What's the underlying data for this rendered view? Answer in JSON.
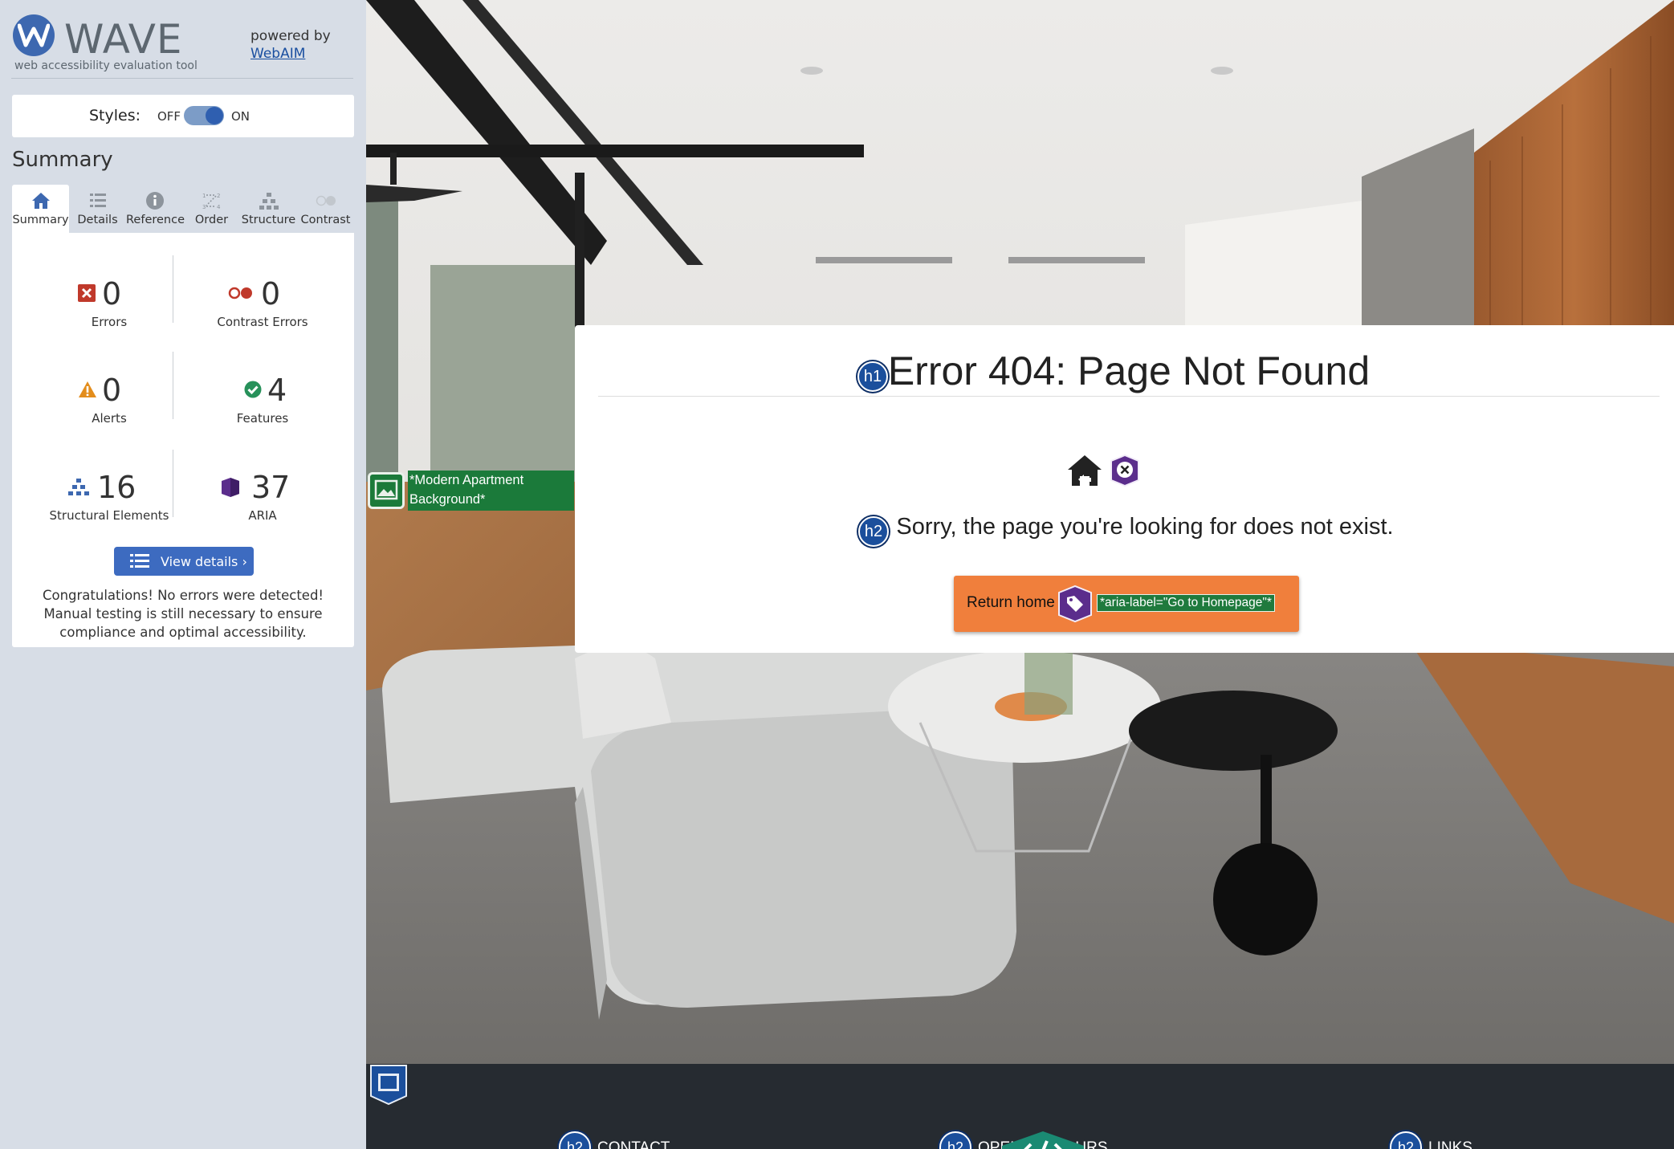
{
  "wave": {
    "logo_word": "WAVE",
    "tagline": "web accessibility evaluation tool",
    "powered_by": "powered by",
    "webaim_link": "WebAIM",
    "styles_label": "Styles:",
    "styles_off": "OFF",
    "styles_on": "ON",
    "styles_enabled": true,
    "summary_title": "Summary",
    "tabs": [
      {
        "label": "Summary",
        "icon": "home-icon",
        "active": true
      },
      {
        "label": "Details",
        "icon": "list-icon",
        "active": false
      },
      {
        "label": "Reference",
        "icon": "info-icon",
        "active": false
      },
      {
        "label": "Order",
        "icon": "order-icon",
        "active": false
      },
      {
        "label": "Structure",
        "icon": "structure-icon",
        "active": false
      },
      {
        "label": "Contrast",
        "icon": "contrast-icon",
        "active": false
      }
    ],
    "stats": {
      "errors": {
        "count": "0",
        "label": "Errors",
        "icon": "error-icon"
      },
      "contrast_errors": {
        "count": "0",
        "label": "Contrast Errors",
        "icon": "contrast-error-icon"
      },
      "alerts": {
        "count": "0",
        "label": "Alerts",
        "icon": "alert-icon"
      },
      "features": {
        "count": "4",
        "label": "Features",
        "icon": "feature-icon"
      },
      "structural": {
        "count": "16",
        "label": "Structural Elements",
        "icon": "structure-icon"
      },
      "aria": {
        "count": "37",
        "label": "ARIA",
        "icon": "aria-icon"
      }
    },
    "view_details": "View details ›",
    "congrats": "Congratulations! No errors were detected! Manual testing is still necessary to ensure compliance and optimal accessibility."
  },
  "page": {
    "h1_badge": "h1",
    "title": "Error 404: Page Not Found",
    "h2_badge": "h2",
    "message": "Sorry, the page you're looking for does not exist.",
    "button_label": "Return home",
    "button_aria_note": "*aria-label=\"Go to Homepage\"*",
    "alt_text_note": "*Modern Apartment Background*",
    "footer": [
      {
        "badge": "h2",
        "label": "CONTACT"
      },
      {
        "badge": "h2",
        "label": "OPENING HOURS"
      },
      {
        "badge": "h2",
        "label": "LINKS"
      }
    ]
  },
  "colors": {
    "wave_blue": "#3d68b0",
    "error_red": "#c0392b",
    "alert_orange": "#e38d1c",
    "feature_green": "#27915a",
    "aria_purple": "#5b2d8c",
    "button_orange": "#f07f3c",
    "footer_bg": "#262b31"
  }
}
